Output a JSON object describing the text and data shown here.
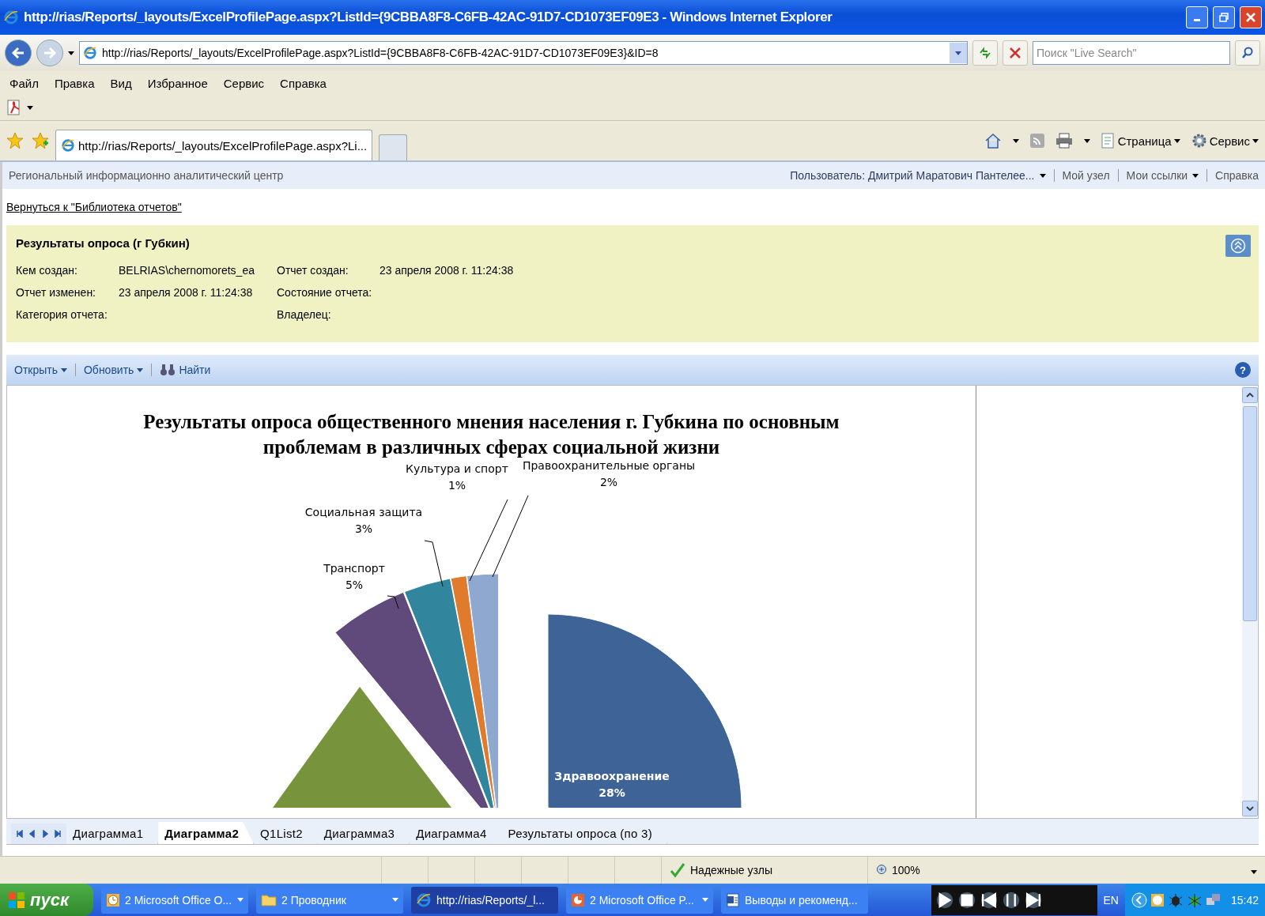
{
  "window": {
    "title": "http://rias/Reports/_layouts/ExcelProfilePage.aspx?ListId={9CBBA8F8-C6FB-42AC-91D7-CD1073EF09E3 - Windows Internet Explorer"
  },
  "address_bar": {
    "url": "http://rias/Reports/_layouts/ExcelProfilePage.aspx?ListId={9CBBA8F8-C6FB-42AC-91D7-CD1073EF09E3}&ID=8"
  },
  "search": {
    "placeholder": "Поиск \"Live Search\""
  },
  "menu": [
    "Файл",
    "Правка",
    "Вид",
    "Избранное",
    "Сервис",
    "Справка"
  ],
  "browser_tabs": [
    {
      "label": "http://rias/Reports/_layouts/ExcelProfilePage.aspx?Li...",
      "selected": true
    }
  ],
  "command_bar": [
    "Страница",
    "Сервис"
  ],
  "site": {
    "name": "Региональный информационно аналитический центр",
    "user": "Пользователь: Дмитрий Маратович Пантелее...",
    "links": [
      {
        "label": "Мой узел",
        "dropdown": false
      },
      {
        "label": "Мои ссылки",
        "dropdown": true
      },
      {
        "label": "Справка",
        "dropdown": false
      }
    ]
  },
  "back_link": "Вернуться к \"Библиотека отчетов\"",
  "report": {
    "title": "Результаты опроса (г Губкин)",
    "fields": [
      {
        "label": "Кем создан:",
        "value": "BELRIAS\\chernomorets_ea"
      },
      {
        "label": "Отчет создан:",
        "value": "23 апреля 2008 г. 11:24:38"
      },
      {
        "label": "Отчет изменен:",
        "value": "23 апреля 2008 г. 11:24:38"
      },
      {
        "label": "Состояние отчета:"
      },
      {
        "label": "Категория отчета:"
      },
      {
        "label": "Владелец:"
      }
    ]
  },
  "toolbar": [
    {
      "label": "Открыть",
      "kind": "menu"
    },
    {
      "label": "Обновить",
      "kind": "menu"
    },
    {
      "label": "Найти",
      "kind": "find"
    }
  ],
  "chart": {
    "title": "Результаты опроса общественного мнения населения г. Губкина  по основным проблемам в различных сферах социальной жизни",
    "slices": [
      {
        "label": "Культура и спорт",
        "share": "1%",
        "color": "#e07b2e"
      },
      {
        "label": "Правоохранительные органы",
        "share": "2%",
        "color": "#8fa8d0"
      },
      {
        "label": "Социальная защита",
        "share": "3%",
        "color": "#31859c"
      },
      {
        "label": "Транспорт",
        "share": "5%",
        "color": "#604a7b"
      },
      {
        "label": "Здравоохранение",
        "share": "28%",
        "color": "#3e6497"
      }
    ],
    "unlabeled_slice": {
      "color": "#77933c"
    }
  },
  "help_label": "?",
  "sheet_tabs": [
    {
      "label": "Диаграмма1",
      "selected": false
    },
    {
      "label": "Диаграмма2",
      "selected": true
    },
    {
      "label": "Q1List2",
      "selected": false
    },
    {
      "label": "Диаграмма3",
      "selected": false
    },
    {
      "label": "Диаграмма4",
      "selected": false
    },
    {
      "label": "Результаты опроса (по 3)",
      "selected": false
    }
  ],
  "status_bar": {
    "zone": "Надежные узлы",
    "zoom": "100%"
  },
  "taskbar": {
    "start": "пуск",
    "tasks": [
      {
        "label": "2 Microsoft Office O...",
        "kind": "clock",
        "group": true,
        "selected": false
      },
      {
        "label": "2 Проводник",
        "kind": "folder",
        "group": true,
        "selected": false
      },
      {
        "label": "http://rias/Reports/_l...",
        "kind": "browser",
        "group": false,
        "selected": true
      },
      {
        "label": "2 Microsoft Office P...",
        "kind": "slides",
        "group": true,
        "selected": false
      },
      {
        "label": "Выводы и рекоменд...",
        "kind": "document",
        "group": false,
        "selected": false
      }
    ],
    "language": "EN",
    "time": "15:42"
  }
}
